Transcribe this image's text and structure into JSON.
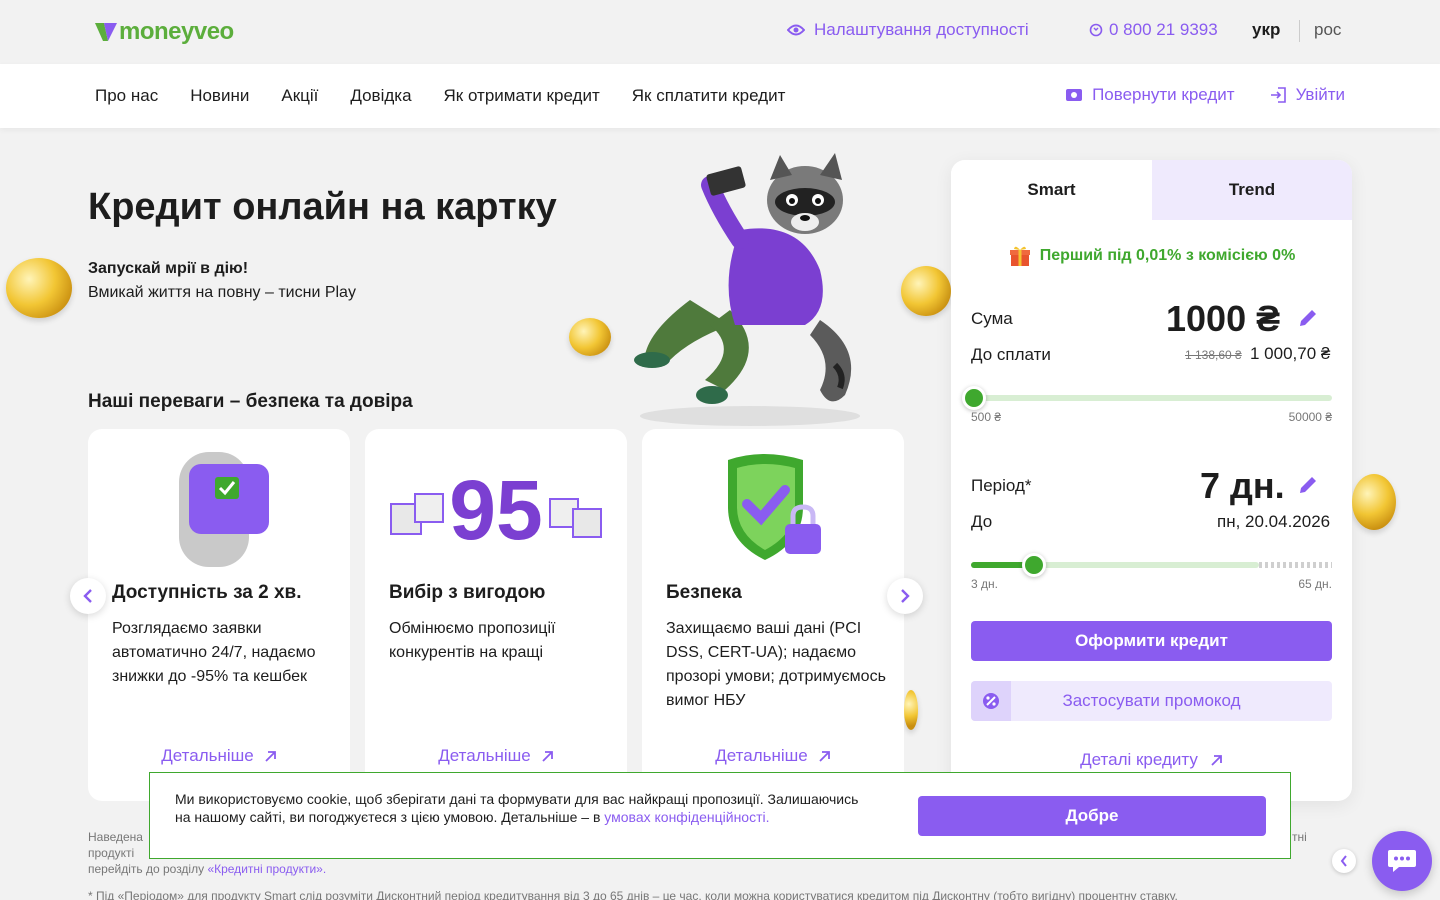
{
  "brand": {
    "name": "moneyveo",
    "accent": "#8a5cf0",
    "green": "#3fa82e"
  },
  "topbar": {
    "accessibility": "Налаштування доступності",
    "phone": "0 800 21 9393",
    "lang_ukr": "укр",
    "lang_ros": "рос"
  },
  "nav": {
    "links": [
      "Про нас",
      "Новини",
      "Акції",
      "Довідка",
      "Як отримати кредит",
      "Як сплатити кредит"
    ],
    "return_credit": "Повернути кредит",
    "login": "Увійти"
  },
  "hero": {
    "title": "Кредит онлайн на картку",
    "subtitle_bold": "Запускай мрії в дію!",
    "subtitle": "Вмикай життя на повну – тисни Play",
    "advantages_title": "Наші переваги – безпека та довіра"
  },
  "cards": [
    {
      "title": "Доступність за 2 хв.",
      "text": "Розглядаємо заявки автоматично 24/7, надаємо знижки до -95% та кешбек",
      "link": "Детальніше",
      "icon": "smartwatch-icon"
    },
    {
      "title": "Вибір з вигодою",
      "text": "Обмінюємо пропозиції конкурентів на кращі",
      "link": "Детальніше",
      "icon": "gift-95-icon",
      "badge_number": "95"
    },
    {
      "title": "Безпека",
      "text": "Захищаємо ваші дані (PCI DSS, CERT-UA); надаємо прозорі умови; дотримуємось вимог НБУ",
      "link": "Детальніше",
      "icon": "shield-lock-icon"
    }
  ],
  "calculator": {
    "tabs": [
      "Smart",
      "Trend"
    ],
    "active_tab": "Smart",
    "promo": "Перший під 0,01% з комісією 0%",
    "sum_label": "Сума",
    "sum_value": "1000 ₴",
    "pay_label": "До сплати",
    "pay_old": "1 138,60 ₴",
    "pay_new": "1 000,70 ₴",
    "sum_min": "500 ₴",
    "sum_max": "50000 ₴",
    "sum_fraction": 0.0,
    "period_label": "Період*",
    "period_value": "7 дн.",
    "until_label": "До",
    "until_value": "пн, 20.04.2026",
    "period_min": "3 дн.",
    "period_max": "65 дн.",
    "period_fraction": 0.065,
    "submit": "Оформити кредит",
    "promocode": "Застосувати промокод",
    "details": "Деталі кредиту"
  },
  "footer": {
    "line1": "Наведена",
    "line1_end": "тні",
    "line2": "продукті",
    "line3_prefix": "перейдіть до розділу ",
    "line3_link": "«Кредитні продукти».",
    "line4": "* Під «Періодом» для продукту Smart слід розуміти Дисконтний період кредитування від 3 до 65 днів – це час, коли можна користуватися кредитом під Дисконтну (тобто вигідну) процентну ставку."
  },
  "cookie": {
    "text": "Ми використовуємо cookie, щоб зберігати дані та формувати для вас найкращі пропозиції. Залишаючись на нашому сайті, ви погоджуєтеся з цією умовою. Детальніше – в ",
    "link": "умовах конфіденційності.",
    "button": "Добре"
  }
}
